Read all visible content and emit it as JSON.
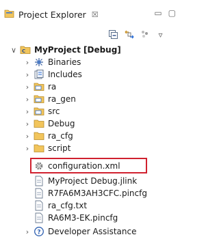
{
  "view": {
    "title": "Project Explorer",
    "close_glyph": "☒",
    "minimize_glyph": "▭",
    "maximize_glyph": "▢"
  },
  "toolbar": {
    "icons": [
      "collapse-all-icon",
      "link-with-editor-icon",
      "filter-icon",
      "view-menu-icon"
    ],
    "view_menu_glyph": "▿"
  },
  "tree": {
    "project": {
      "label": "MyProject [Debug]",
      "expanded": true
    },
    "items": [
      {
        "label": "Binaries",
        "icon": "binaries-icon",
        "twisty": "›"
      },
      {
        "label": "Includes",
        "icon": "includes-icon",
        "twisty": "›"
      },
      {
        "label": "ra",
        "icon": "source-folder-icon",
        "twisty": "›"
      },
      {
        "label": "ra_gen",
        "icon": "source-folder-icon",
        "twisty": "›"
      },
      {
        "label": "src",
        "icon": "source-folder-icon",
        "twisty": "›"
      },
      {
        "label": "Debug",
        "icon": "folder-icon",
        "twisty": "›"
      },
      {
        "label": "ra_cfg",
        "icon": "folder-icon",
        "twisty": "›"
      },
      {
        "label": "script",
        "icon": "folder-icon",
        "twisty": "›"
      },
      {
        "label": "configuration.xml",
        "icon": "gear-file-icon",
        "twisty": ""
      },
      {
        "label": "MyProject Debug.jlink",
        "icon": "file-icon",
        "twisty": ""
      },
      {
        "label": "R7FA6M3AH3CFC.pincfg",
        "icon": "file-icon",
        "twisty": ""
      },
      {
        "label": "ra_cfg.txt",
        "icon": "file-icon",
        "twisty": ""
      },
      {
        "label": "RA6M3-EK.pincfg",
        "icon": "file-icon",
        "twisty": ""
      }
    ],
    "developer_assistance": {
      "label": "Developer Assistance",
      "twisty": "›"
    }
  },
  "colors": {
    "highlight_border": "#d0202e",
    "folder_fill": "#f2c55c",
    "source_folder_badge": "#2d6fd6"
  }
}
